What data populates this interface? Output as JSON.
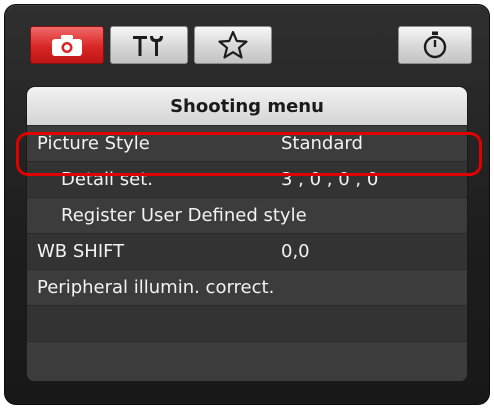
{
  "tabs": [
    {
      "icon": "camera-icon",
      "active": true
    },
    {
      "icon": "tools-icon",
      "active": false
    },
    {
      "icon": "star-icon",
      "active": false
    },
    {
      "icon": "timer-icon",
      "active": false
    }
  ],
  "menu": {
    "title": "Shooting menu",
    "items": [
      {
        "label": "Picture Style",
        "value": "Standard",
        "highlighted": true
      },
      {
        "label": "Detail set.",
        "value": "3 , 0 , 0 , 0"
      },
      {
        "label": "Register User Defined style",
        "value": ""
      },
      {
        "label": "WB SHIFT",
        "value": "0,0"
      },
      {
        "label": "Peripheral illumin. correct.",
        "value": ""
      },
      {
        "label": "",
        "value": ""
      },
      {
        "label": "",
        "value": ""
      }
    ]
  },
  "colors": {
    "active_tab": "#d92626",
    "highlight_outline": "#e00000"
  }
}
